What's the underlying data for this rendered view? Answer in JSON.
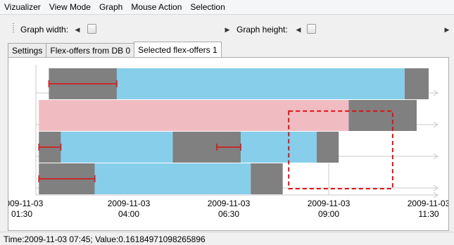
{
  "menu": [
    "Vizualizer",
    "View Mode",
    "Graph",
    "Mouse Action",
    "Selection"
  ],
  "toolbar": {
    "graph_width_label": "Graph width:",
    "graph_height_label": "Graph height:",
    "left_arrow": "◀",
    "right_arrow": "▶"
  },
  "tabs": [
    {
      "label": "Settings",
      "active": false
    },
    {
      "label": "Flex-offers from DB 0",
      "active": false
    },
    {
      "label": "Selected flex-offers 1",
      "active": true
    }
  ],
  "colors": {
    "blue": "#87ceeb",
    "gray": "#808080",
    "pink": "#f0bcc2",
    "red": "#dd1111",
    "arrow": "#c8c8c8"
  },
  "chart_data": {
    "type": "gantt",
    "x_ticks": [
      {
        "date": "2009-11-03",
        "time": "01:30"
      },
      {
        "date": "2009-11-03",
        "time": "04:00"
      },
      {
        "date": "2009-11-03",
        "time": "06:30"
      },
      {
        "date": "2009-11-03",
        "time": "09:00"
      },
      {
        "date": "2009-11-03",
        "time": "11:30"
      }
    ],
    "x_range_hours": [
      1.5,
      11.5
    ],
    "rows": [
      {
        "segments": [
          {
            "kind": "gray",
            "start": 2.0,
            "end": 3.7
          },
          {
            "kind": "blue",
            "start": 3.7,
            "end": 10.9
          },
          {
            "kind": "gray",
            "start": 10.9,
            "end": 11.5
          }
        ],
        "ranges": [
          {
            "start": 2.0,
            "end": 3.7
          }
        ]
      },
      {
        "segments": [
          {
            "kind": "pink",
            "start": 1.75,
            "end": 9.5
          },
          {
            "kind": "gray",
            "start": 9.5,
            "end": 11.2
          }
        ],
        "ranges": []
      },
      {
        "segments": [
          {
            "kind": "gray",
            "start": 1.75,
            "end": 2.3
          },
          {
            "kind": "blue",
            "start": 2.3,
            "end": 5.1
          },
          {
            "kind": "gray",
            "start": 5.1,
            "end": 6.8
          },
          {
            "kind": "blue",
            "start": 6.8,
            "end": 8.7
          },
          {
            "kind": "gray",
            "start": 8.7,
            "end": 9.25
          }
        ],
        "ranges": [
          {
            "start": 1.75,
            "end": 2.3
          },
          {
            "start": 6.2,
            "end": 6.8
          }
        ]
      },
      {
        "segments": [
          {
            "kind": "gray",
            "start": 1.75,
            "end": 3.15
          },
          {
            "kind": "blue",
            "start": 3.15,
            "end": 7.05
          },
          {
            "kind": "gray",
            "start": 7.05,
            "end": 7.85
          }
        ],
        "ranges": [
          {
            "start": 1.75,
            "end": 3.15
          }
        ]
      }
    ],
    "cursor_hour": 9.0,
    "selection": {
      "start_hour": 8.0,
      "end_hour": 10.6,
      "row_from": 1.35,
      "row_to": 3.8
    }
  },
  "status": {
    "text": "Time:2009-11-03 07:45; Value:0.16184971098265896"
  }
}
